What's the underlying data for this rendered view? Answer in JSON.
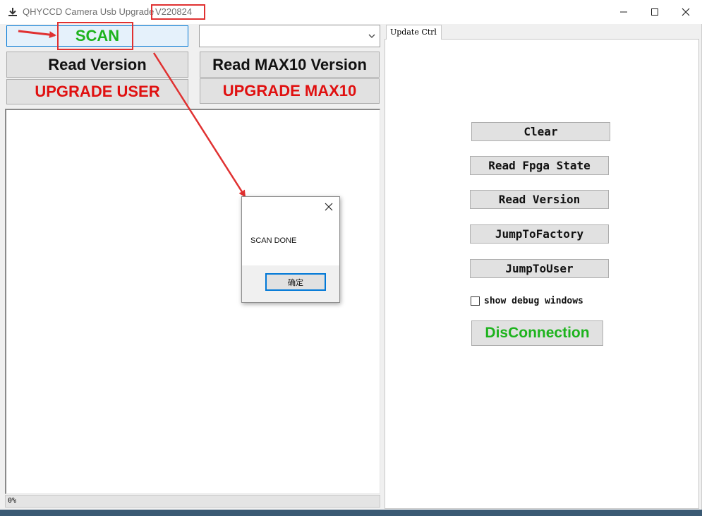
{
  "window": {
    "title": "QHYCCD Camera Usb Upgrade",
    "version": "V220824"
  },
  "toolbar": {
    "scan_label": "SCAN",
    "read_version_label": "Read Version",
    "read_max10_label": "Read MAX10 Version",
    "upgrade_user_label": "UPGRADE USER",
    "upgrade_max10_label": "UPGRADE MAX10",
    "device_select_value": ""
  },
  "status": {
    "progress_text": "0%",
    "progress_value": 0
  },
  "tabs": [
    {
      "label": "Update Ctrl"
    }
  ],
  "update_ctrl": {
    "clear_label": "Clear",
    "read_fpga_state_label": "Read Fpga State",
    "read_version_label": "Read Version",
    "jump_to_factory_label": "JumpToFactory",
    "jump_to_user_label": "JumpToUser",
    "show_debug_label": "show debug windows",
    "show_debug_checked": false,
    "disconnection_label": "DisConnection"
  },
  "dialog": {
    "message": "SCAN DONE",
    "ok_label": "确定"
  },
  "colors": {
    "scan_text": "#1db31d",
    "upgrade_text": "#e01010",
    "disconnection_text": "#1db31d",
    "annotation": "#e03131",
    "dialog_focus": "#0078d7"
  },
  "icons": {
    "app": "download-icon",
    "minimize": "minimize-icon",
    "maximize": "maximize-icon",
    "close": "close-icon",
    "dropdown": "chevron-down-icon",
    "dialog_close": "close-icon"
  }
}
